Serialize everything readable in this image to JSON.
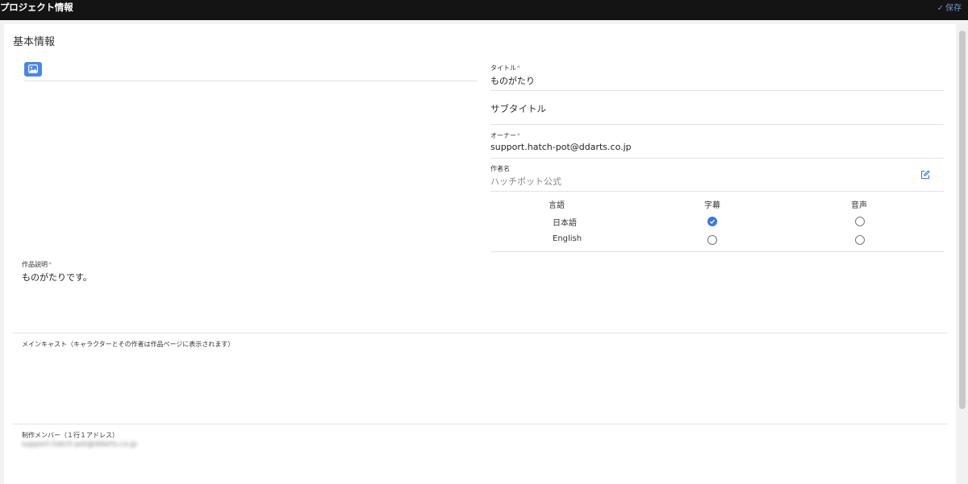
{
  "header": {
    "title": "プロジェクト情報",
    "save_label": "保存",
    "save_icon": "check-icon"
  },
  "section": {
    "title": "基本情報"
  },
  "image_button": {
    "icon": "image-icon"
  },
  "fields": {
    "title": {
      "label": "タイトル",
      "required": "*",
      "value": "ものがたり"
    },
    "subtitle": {
      "placeholder": "サブタイトル"
    },
    "owner": {
      "label": "オーナー",
      "required": "*",
      "value": "support.hatch-pot@ddarts.co.jp"
    },
    "author": {
      "label": "作者名",
      "value": "ハッチポット公式",
      "edit_icon": "edit-icon"
    },
    "description": {
      "label": "作品説明",
      "required": "*",
      "value": "ものがたりです。"
    },
    "main_cast": {
      "label": "メインキャスト（キャラクターとその作者は作品ページに表示されます）"
    },
    "members": {
      "label": "制作メンバー（１行１アドレス）",
      "value": "support.hatch-pot@ddarts.co.jp"
    }
  },
  "languages": {
    "headers": [
      "言語",
      "字幕",
      "音声"
    ],
    "rows": [
      {
        "name": "日本語",
        "subtitle": true,
        "audio": false
      },
      {
        "name": "English",
        "subtitle": false,
        "audio": false
      }
    ]
  },
  "colors": {
    "accent": "#3b76e0",
    "topbar": "#141414"
  }
}
